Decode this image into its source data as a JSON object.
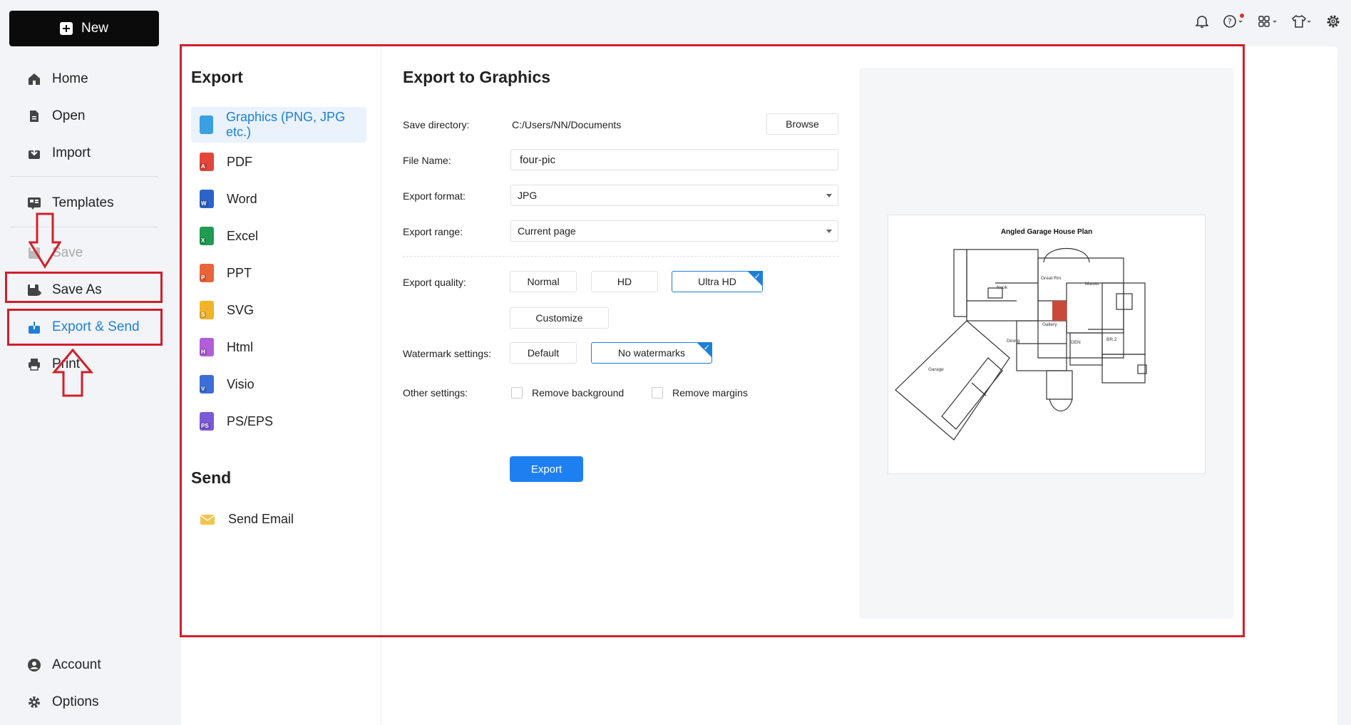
{
  "sidebar": {
    "new_label": "New",
    "items": [
      {
        "label": "Home",
        "icon": "home-icon"
      },
      {
        "label": "Open",
        "icon": "open-file-icon"
      },
      {
        "label": "Import",
        "icon": "import-icon"
      },
      {
        "label": "Templates",
        "icon": "templates-icon"
      },
      {
        "label": "Save",
        "icon": "save-icon"
      },
      {
        "label": "Save As",
        "icon": "save-as-icon"
      },
      {
        "label": "Export & Send",
        "icon": "export-icon"
      },
      {
        "label": "Print",
        "icon": "print-icon"
      },
      {
        "label": "Account",
        "icon": "account-icon"
      },
      {
        "label": "Options",
        "icon": "gear-icon"
      }
    ]
  },
  "topbar": {
    "icons": [
      "bell-icon",
      "help-icon",
      "apps-icon",
      "shirt-icon",
      "settings-icon"
    ]
  },
  "export_panel": {
    "export_heading": "Export",
    "formats": [
      {
        "label": "Graphics (PNG, JPG etc.)",
        "icon": "image-file-icon",
        "color": "#3aa0e0",
        "badge": ""
      },
      {
        "label": "PDF",
        "icon": "pdf-file-icon",
        "color": "#e2463b",
        "badge": "A"
      },
      {
        "label": "Word",
        "icon": "word-file-icon",
        "color": "#2b63c9",
        "badge": "W"
      },
      {
        "label": "Excel",
        "icon": "excel-file-icon",
        "color": "#1f9b52",
        "badge": "X"
      },
      {
        "label": "PPT",
        "icon": "ppt-file-icon",
        "color": "#e8643a",
        "badge": "P"
      },
      {
        "label": "SVG",
        "icon": "svg-file-icon",
        "color": "#f0b429",
        "badge": "S"
      },
      {
        "label": "Html",
        "icon": "html-file-icon",
        "color": "#b05fd8",
        "badge": "H"
      },
      {
        "label": "Visio",
        "icon": "visio-file-icon",
        "color": "#3b6fd6",
        "badge": "V"
      },
      {
        "label": "PS/EPS",
        "icon": "ps-file-icon",
        "color": "#7a5ad8",
        "badge": "PS"
      }
    ],
    "send_heading": "Send",
    "send_email": "Send Email",
    "email_icon": "envelope-icon"
  },
  "form": {
    "title": "Export to Graphics",
    "save_directory_label": "Save directory:",
    "save_directory_value": "C:/Users/NN/Documents",
    "browse_label": "Browse",
    "file_name_label": "File Name:",
    "file_name_value": "four-pic",
    "export_format_label": "Export format:",
    "export_format_value": "JPG",
    "export_range_label": "Export range:",
    "export_range_value": "Current page",
    "export_quality_label": "Export quality:",
    "quality_normal": "Normal",
    "quality_hd": "HD",
    "quality_ultra": "Ultra HD",
    "quality_selected": "Ultra HD",
    "customize_label": "Customize",
    "watermark_label": "Watermark settings:",
    "watermark_default": "Default",
    "watermark_none": "No watermarks",
    "watermark_selected": "No watermarks",
    "other_settings_label": "Other settings:",
    "remove_background": "Remove background",
    "remove_margins": "Remove margins",
    "export_button": "Export"
  },
  "preview": {
    "plan_title": "Angled Garage House Plan",
    "room_labels": [
      "Great Rm",
      "Master",
      "Nook",
      "Gallery",
      "Dining",
      "DEN",
      "BR.2",
      "Garage"
    ]
  },
  "colors": {
    "accent": "#1e7fd6",
    "annotation_red": "#d11f2b",
    "primary_button": "#1e80f0"
  }
}
